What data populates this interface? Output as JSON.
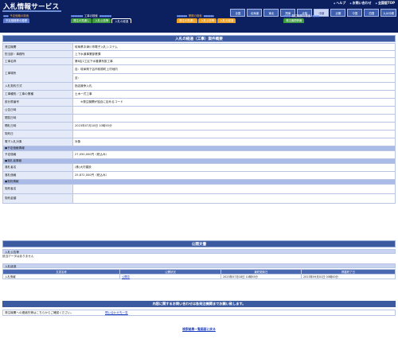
{
  "header": {
    "app_title": "入札情報サービス",
    "top_links": [
      "ヘルプ",
      "お問い合わせ",
      "全国版TOP"
    ],
    "regions": [
      "全国",
      "北海道",
      "東北",
      "関東",
      "北陸",
      "中部",
      "近畿",
      "中国",
      "四国",
      "九州沖縄"
    ],
    "selected_region": "中部",
    "nav": {
      "project_search": {
        "head": "工事の検索",
        "tabs": [
          "発注の見通し",
          "入札公告等",
          "入札の経過"
        ],
        "active_tab": "入札の経過"
      },
      "contract_search": {
        "head": "業務の検索",
        "tabs": [
          "発注の見通し",
          "入札公告等",
          "入札の経過"
        ]
      },
      "agency_search": {
        "head": "発注機関の検索",
        "tabs": [
          "発注機関情報"
        ]
      },
      "left_tab": {
        "head": "予定価格の検索",
        "tab": "予定価格等の推移"
      }
    }
  },
  "detail": {
    "title": "入札の経過（工事）案件概要",
    "rows": [
      {
        "label": "発注機関",
        "value": "岐阜県中津川市電子入札システム"
      },
      {
        "label": "担当部・事務所",
        "value": "上下水道事業部業課"
      },
      {
        "label": "工事名称",
        "value": "第8区2工区下水管渠布設工事"
      },
      {
        "label": "工事場所",
        "value": "自：岐阜県下呂市萩原町上村地内"
      },
      {
        "label": "",
        "value": "至："
      },
      {
        "label": "入札契約方式",
        "value": "指名競争入札"
      },
      {
        "label": "工事種別／工事の業種",
        "value": "土木一式工事"
      },
      {
        "label": "設計書番号",
        "value": "　　※発注機関が独自に定めるコード"
      },
      {
        "label": "公告日時",
        "value": ""
      },
      {
        "label": "閲覧日時",
        "value": ""
      },
      {
        "label": "開札日時",
        "value": "2023年07月18日 10時55分"
      },
      {
        "label": "契約日",
        "value": ""
      },
      {
        "label": "電子入札対象",
        "value": "対象"
      }
    ],
    "group_price": "●予定価格情報",
    "price_row": {
      "label": "予定価格",
      "value": "27,050,000円（税込み）"
    },
    "group_award": "●落札者情報",
    "award_rows": [
      {
        "label": "落札者名",
        "value": "(株)大村建設"
      },
      {
        "label": "落札価格",
        "value": "25,872,000円（税込み）"
      }
    ],
    "group_contract": "●契約情報",
    "contract_rows": [
      {
        "label": "契約者名",
        "value": ""
      },
      {
        "label": "契約金額",
        "value": ""
      }
    ]
  },
  "public_docs": {
    "title": "公開文書",
    "notice_head": "入札公告等",
    "notice_empty": "該当データはありません",
    "progress_head": "入札経過",
    "columns": [
      "文書名称",
      "公開状況",
      "最終更新日",
      "掲載終了日"
    ],
    "rows": [
      {
        "name": "入札情報",
        "status": "公開中",
        "updated": "2023年07月18日 10時55分",
        "end": "2023年09月01日 00時00分"
      }
    ]
  },
  "inquiry": {
    "banner": "内容に関するお問い合わせは各発注機関までお願い致します。",
    "left_text": "発注機関への連絡先等はこちらからご確認ください。",
    "link_text": "問い合わせ先一覧"
  },
  "back_link": "検索結果一覧画面に戻る",
  "colors": {
    "navy": "#0c1f5e",
    "section_bar": "#3c5aa0",
    "label_bg": "#e4eaf8"
  }
}
